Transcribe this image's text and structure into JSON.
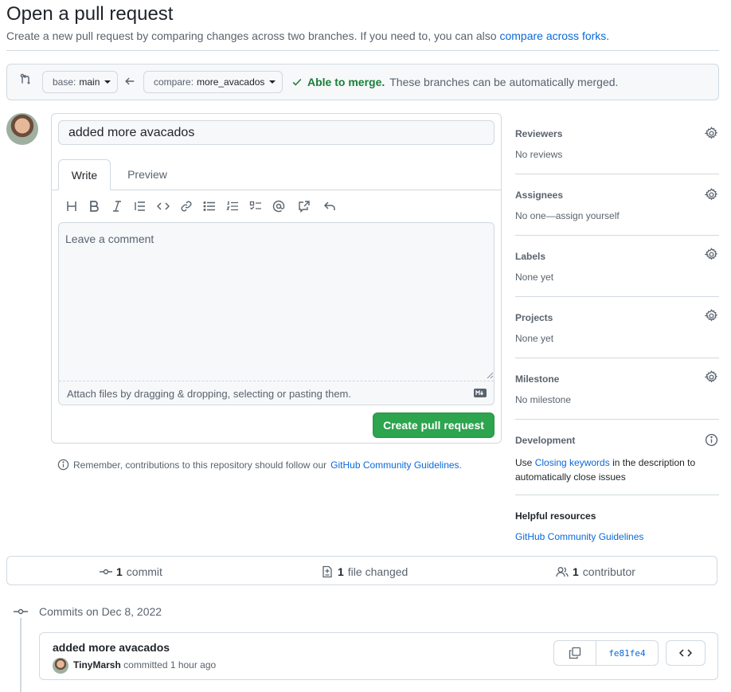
{
  "header": {
    "title": "Open a pull request",
    "subtitle": "Create a new pull request by comparing changes across two branches. If you need to, you can also",
    "subtitle_link": "compare across forks."
  },
  "compare": {
    "base_prefix": "base:",
    "base_branch": "main",
    "compare_prefix": "compare:",
    "compare_branch": "more_avacados",
    "merge_status": "Able to merge.",
    "merge_text": "These branches can be automatically merged."
  },
  "composer": {
    "title_value": "added more avacados",
    "tabs": [
      "Write",
      "Preview"
    ],
    "toolbar_icons": [
      "heading-icon",
      "bold-icon",
      "italic-icon",
      "quote-icon",
      "code-icon",
      "link-icon",
      "bulleted-list-icon",
      "numbered-list-icon",
      "task-list-icon",
      "mention-icon",
      "cross-reference-icon",
      "reply-icon"
    ],
    "placeholder": "Leave a comment",
    "attach_text": "Attach files by dragging & dropping, selecting or pasting them.",
    "create_button": "Create pull request"
  },
  "notice": {
    "text": "Remember, contributions to this repository should follow our",
    "link": "GitHub Community Guidelines."
  },
  "sidebar": {
    "reviewers": {
      "title": "Reviewers",
      "value": "No reviews"
    },
    "assignees": {
      "title": "Assignees",
      "value": "No one—assign yourself"
    },
    "labels": {
      "title": "Labels",
      "value": "None yet"
    },
    "projects": {
      "title": "Projects",
      "value": "None yet"
    },
    "milestone": {
      "title": "Milestone",
      "value": "No milestone"
    },
    "development": {
      "title": "Development",
      "pre": "Use",
      "link": "Closing keywords",
      "post": "in the description to",
      "post2": "automatically close issues"
    },
    "resources": {
      "title": "Helpful resources",
      "link": "GitHub Community Guidelines"
    }
  },
  "stats": {
    "commits_count": "1",
    "commits_label": "commit",
    "files_count": "1",
    "files_label": "file changed",
    "contributors_count": "1",
    "contributors_label": "contributor"
  },
  "commits": {
    "heading": "Commits on Dec 8, 2022",
    "items": [
      {
        "message": "added more avacados",
        "author": "TinyMarsh",
        "action": "committed 1 hour ago",
        "sha": "fe81fe4"
      }
    ]
  }
}
